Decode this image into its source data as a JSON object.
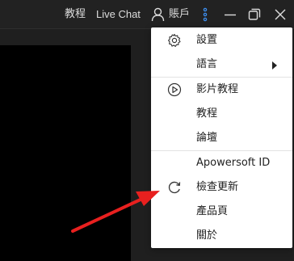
{
  "titlebar": {
    "tutorial_label": "教程",
    "livechat_label": "Live Chat",
    "account_label": "賬戶"
  },
  "menu": {
    "items": [
      {
        "label": "設置",
        "icon": "gear-icon"
      },
      {
        "label": "語言",
        "icon": "",
        "submenu": true
      },
      {
        "label": "影片教程",
        "icon": "play-circle-icon"
      },
      {
        "label": "教程",
        "icon": ""
      },
      {
        "label": "論壇",
        "icon": ""
      },
      {
        "label": "Apowersoft ID",
        "icon": ""
      },
      {
        "label": "檢查更新",
        "icon": "refresh-icon"
      },
      {
        "label": "產品頁",
        "icon": ""
      },
      {
        "label": "關於",
        "icon": ""
      }
    ]
  },
  "colors": {
    "titlebar_bg": "#222222",
    "menu_bg": "#ffffff",
    "arrow": "#e8201f",
    "video_bg": "#000000"
  }
}
